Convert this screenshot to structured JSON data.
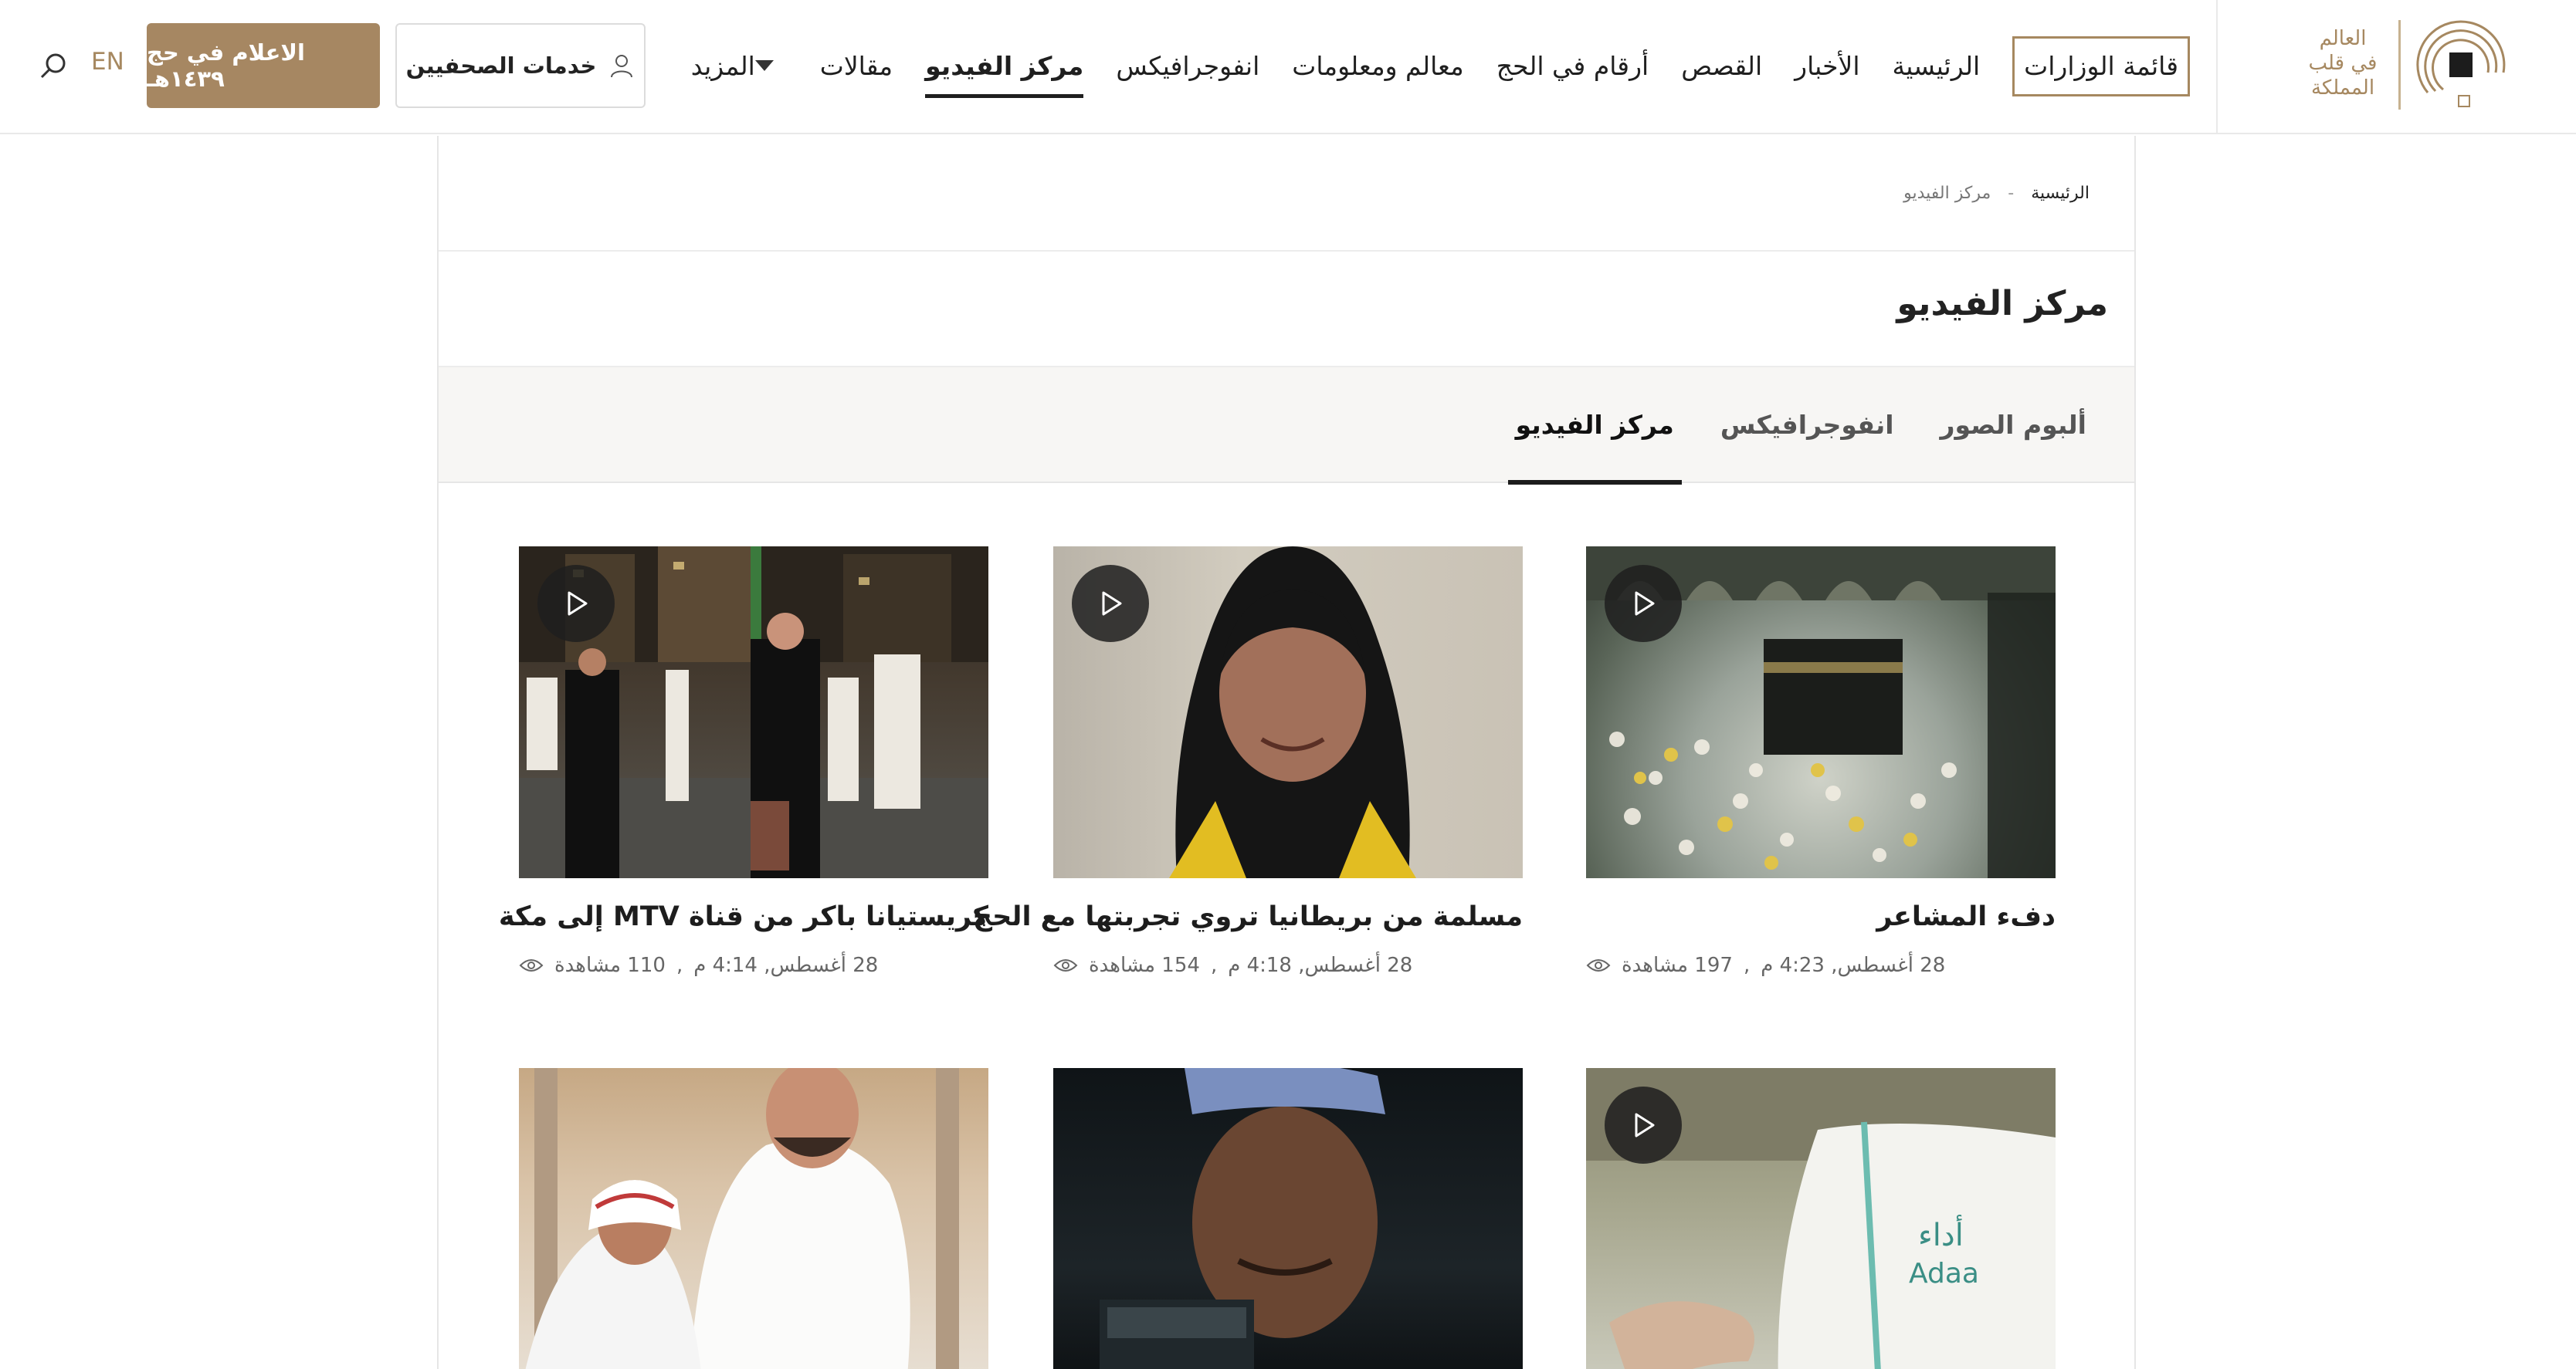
{
  "header": {
    "logo": {
      "lines": [
        "العالم",
        "في قلب",
        "المملكة"
      ],
      "icon": "logo-arc-mark"
    },
    "nav": [
      {
        "label": "قائمة الوزارات",
        "boxed": true
      },
      {
        "label": "الرئيسية"
      },
      {
        "label": "الأخبار"
      },
      {
        "label": "القصص"
      },
      {
        "label": "أرقام في الحج"
      },
      {
        "label": "معالم ومعلومات"
      },
      {
        "label": "انفوجرافيكس"
      },
      {
        "label": "مركز الفيديو",
        "active": true
      },
      {
        "label": "مقالات"
      },
      {
        "label": "المزيد",
        "has_dropdown": true
      }
    ],
    "press_button": {
      "label": "خدمات الصحفيين",
      "icon": "user-icon"
    },
    "media_button": {
      "label": "الاعلام في حج ١٤٣٩هـ"
    },
    "language_toggle": "EN",
    "search_icon": "search-icon"
  },
  "breadcrumb": {
    "home": "الرئيسية",
    "separator": "-",
    "current": "مركز الفيديو"
  },
  "page_title": "مركز الفيديو",
  "tabs": [
    {
      "label": "ألبوم الصور"
    },
    {
      "label": "انفوجرافيكس"
    },
    {
      "label": "مركز الفيديو",
      "active": true
    }
  ],
  "videos": [
    {
      "title": "دفء المشاعر",
      "views": "197 مشاهدة",
      "date": "28 أغسطس, 4:23 م"
    },
    {
      "title": "مسلمة من بريطانيا تروي تجربتها مع الحج",
      "views": "154 مشاهدة",
      "date": "28 أغسطس, 4:18 م"
    },
    {
      "title": "كريستيانا باكر من قناة MTV إلى مكة",
      "views": "110 مشاهدة",
      "date": "28 أغسطس, 4:14 م"
    }
  ],
  "thumbnail_text": {
    "adaa_arabic": "أداء",
    "adaa_latin": "Adaa"
  },
  "colors": {
    "accent_gold": "#a68860",
    "button_brown": "#a68762",
    "text_dark": "#1c1c1c"
  }
}
